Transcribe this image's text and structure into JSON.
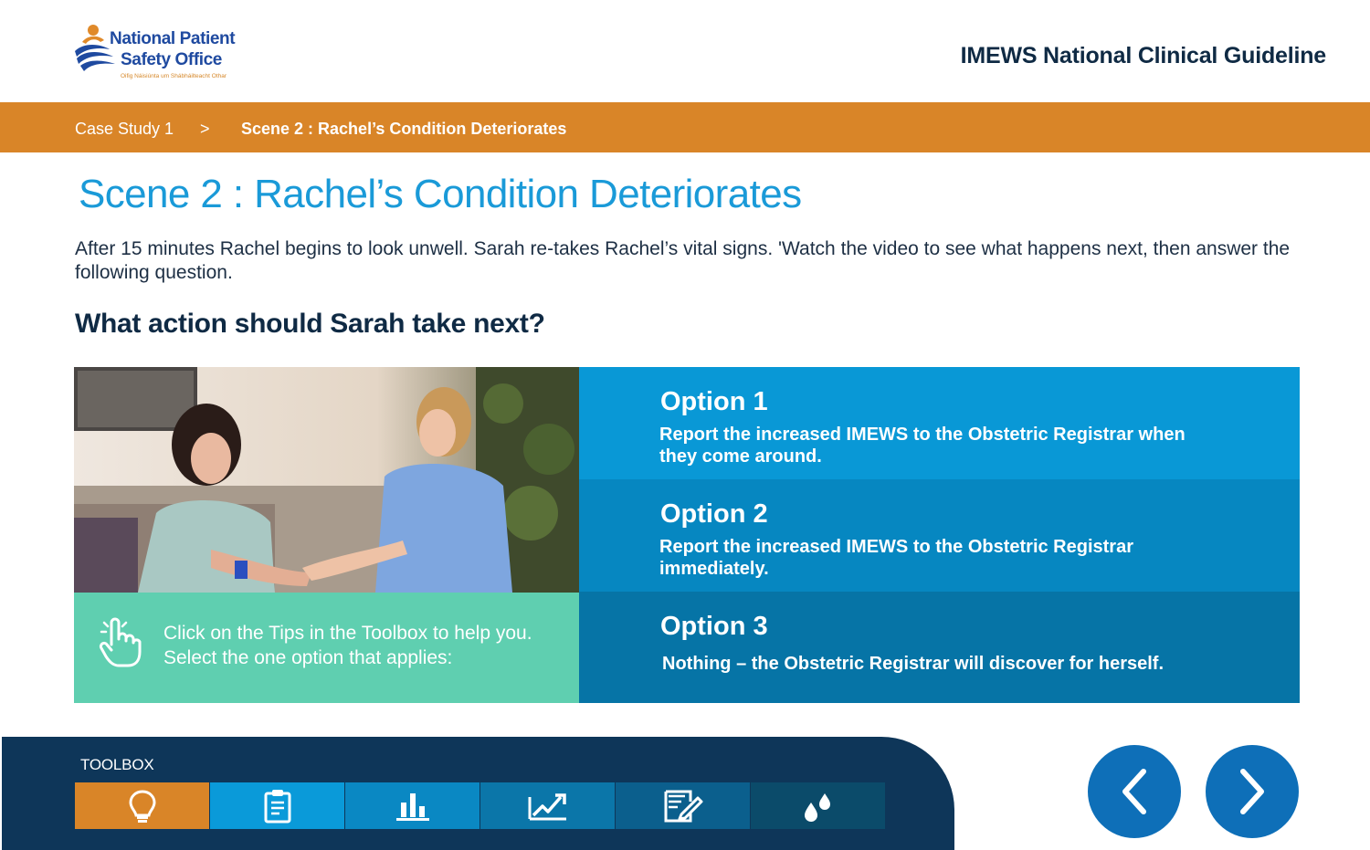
{
  "header": {
    "logo": {
      "line1": "National Patient",
      "line2": "Safety Office",
      "subtitle": "Oifig Náisiúnta um Shábháilteacht Othar"
    },
    "guideline_title": "IMEWS National Clinical Guideline"
  },
  "breadcrumb": {
    "items": [
      "Case Study 1",
      "Scene 2 : Rachel’s Condition Deteriorates"
    ],
    "separator": ">"
  },
  "main": {
    "scene_title": "Scene 2 : Rachel’s Condition Deteriorates",
    "intro": "After 15 minutes Rachel begins to look unwell. Sarah re-takes Rachel’s vital signs. 'Watch the video to see what happens next, then answer the following question.",
    "question": "What action should Sarah take next?",
    "tips": {
      "icon": "pointing-hand-icon",
      "line1": "Click on the Tips in the Toolbox to help you.",
      "line2": "Select the one option that applies:"
    },
    "options": [
      {
        "title": "Option 1",
        "text": "Report the increased IMEWS to the Obstetric Registrar when they come around."
      },
      {
        "title": "Option 2",
        "text": "Report the increased IMEWS to the Obstetric Registrar immediately."
      },
      {
        "title": "Option 3",
        "text": "Nothing – the Obstetric Registrar will discover for herself."
      }
    ]
  },
  "toolbox": {
    "label": "TOOLBOX",
    "tools": [
      {
        "icon": "lightbulb-icon",
        "color": "#d98528"
      },
      {
        "icon": "clipboard-icon",
        "color": "#0a9ad9"
      },
      {
        "icon": "bar-chart-icon",
        "color": "#0a88c3"
      },
      {
        "icon": "trend-chart-icon",
        "color": "#0b76a9"
      },
      {
        "icon": "edit-document-icon",
        "color": "#0b5f8d"
      },
      {
        "icon": "drops-icon",
        "color": "#0b4b6a"
      }
    ]
  },
  "navigation": {
    "prev_icon": "chevron-left-icon",
    "next_icon": "chevron-right-icon"
  },
  "colors": {
    "brand_orange": "#d98528",
    "title_blue": "#1a9ad8",
    "navy": "#0e3659",
    "tips_green": "#5fcfb0",
    "nav_blue": "#0e6fb8"
  }
}
